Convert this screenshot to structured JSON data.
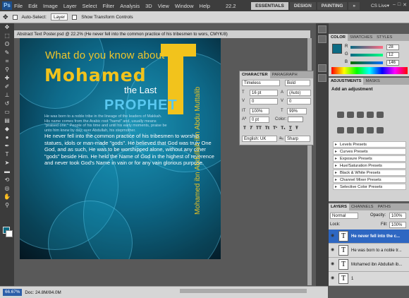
{
  "app": {
    "logo": "Ps",
    "menus": [
      "File",
      "Edit",
      "Image",
      "Layer",
      "Select",
      "Filter",
      "Analysis",
      "3D",
      "View",
      "Window",
      "Help"
    ],
    "zoom_display": "22.2",
    "workspaces": [
      "ESSENTIALS",
      "DESIGN",
      "PAINTING"
    ],
    "active_workspace": "ESSENTIALS",
    "more": "»",
    "cs_live": "CS Live▾"
  },
  "options": {
    "auto_select_label": "Auto-Select:",
    "auto_select_value": "Layer",
    "transform_label": "Show Transform Controls"
  },
  "document": {
    "tab_title": "Abstract Text Poster.psd @ 22.2% (He never fell into the common practice of his tribesmen to wors, CMYK/8)",
    "status_zoom": "22.22%",
    "status_doc": "Doc: 24.8M/84.0M"
  },
  "poster": {
    "line1": "What do you know about",
    "line2": "Mohamed",
    "line3": "the Last",
    "line4": "PROPHET",
    "intro": "He was born to a noble tribe in the lineage of the leaders of Makkah. His name comes from the Arabic root \"hamd\" and, usually means \"praised one.\" People of his time and until his early moments, praise be unto him knew by day, over Abdullah, his stepmother.",
    "body": "He never fell into the common practice of his tribesmen to worship statues, idols or man-made \"gods\". He believed that God was truly One God, and as such, He was to be worshipped alone, without any other \"gods\" beside Him. He held the Name of God in the highest of reverence and never took God's Name in vain or for any vain glorious purpose.",
    "vertical": "Mohamed ibn Abdullah ibn Abdu Muttalib"
  },
  "character": {
    "tabs": [
      "CHARACTER",
      "PARAGRAPH"
    ],
    "font": "Timeless",
    "style": "Bold",
    "size": "16 pt",
    "leading": "(Auto)",
    "kerning": "0",
    "tracking": "0",
    "vscale": "100%",
    "hscale": "99%",
    "baseline": "0 pt",
    "color_label": "Color:",
    "styles": [
      "T",
      "T",
      "TT",
      "Tt",
      "T¹",
      "T₁",
      "T",
      "Ŧ"
    ],
    "language": "English: UK",
    "antialias": "Sharp",
    "aa_label": "aₐ"
  },
  "color_panel": {
    "tabs": [
      "COLOR",
      "SWATCHES",
      "STYLES"
    ],
    "r_label": "R",
    "g_label": "G",
    "b_label": "B",
    "r": "28",
    "g": "12",
    "b": "146",
    "fg": "#0b6b84"
  },
  "adjustments": {
    "tabs": [
      "ADJUSTMENTS",
      "MASKS"
    ],
    "title": "Add an adjustment",
    "presets": [
      "Levels Presets",
      "Curves Presets",
      "Exposure Presets",
      "Hue/Saturation Presets",
      "Black & White Presets",
      "Channel Mixer Presets",
      "Selective Color Presets"
    ]
  },
  "layers": {
    "tabs": [
      "LAYERS",
      "CHANNELS",
      "PATHS"
    ],
    "blend": "Normal",
    "opacity_label": "Opacity:",
    "opacity": "100%",
    "lock_label": "Lock:",
    "fill_label": "Fill:",
    "fill": "100%",
    "rows": [
      "He never fell into the c...",
      "He was born to a noble tr...",
      "Mohamed ibn Abdullah ib...",
      "1"
    ]
  },
  "status": {
    "left": "66.67%"
  }
}
